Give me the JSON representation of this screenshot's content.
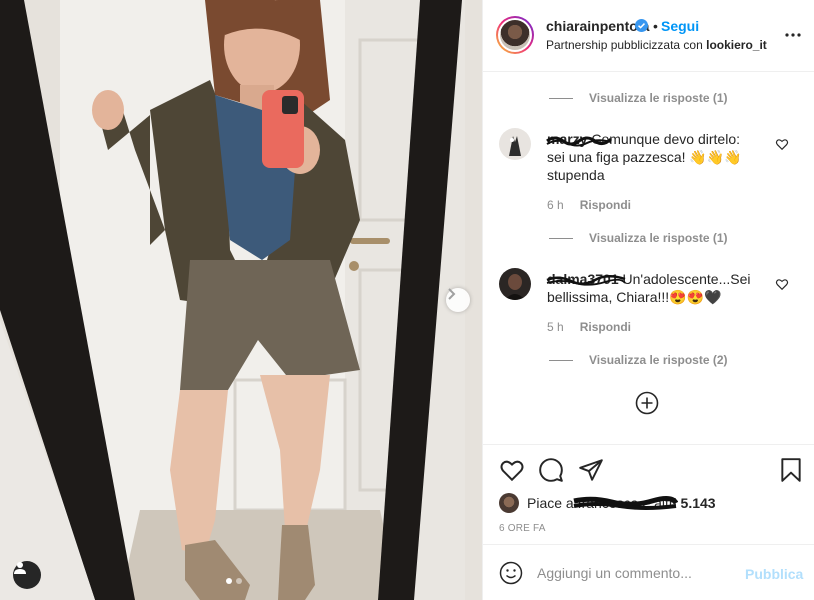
{
  "post": {
    "username": "chiarainpentola",
    "separator": "•",
    "follow_label": "Segui",
    "partnership_prefix": "Partnership pubblicizzata con",
    "partner": "lookiero_it",
    "more_icon": "more-options-icon"
  },
  "comments": {
    "view_replies_1": "Visualizza le risposte (1)",
    "comment_1": {
      "username": "marzy",
      "text": "Comunque devo dirtelo: sei una figa pazzesca! 👋👋👋 stupenda",
      "time": "6 h",
      "reply_label": "Rispondi"
    },
    "view_replies_2": "Visualizza le risposte (1)",
    "comment_2": {
      "username": "dalma3701",
      "text": "Un'adolescente...Sei bellissima, Chiara!!!😍😍🖤",
      "time": "5 h",
      "reply_label": "Rispondi"
    },
    "view_replies_3": "Visualizza le risposte (2)"
  },
  "actions": {
    "likes_prefix": "Piace a",
    "likes_user": "francesca",
    "likes_suffix": "e altri",
    "likes_count": "5.143",
    "timestamp": "6 ORE FA"
  },
  "add_comment": {
    "placeholder": "Aggiungi un commento...",
    "publish_label": "Pubblica"
  },
  "carousel": {
    "total_slides": 2,
    "active_slide": 1
  },
  "colors": {
    "accent": "#0095f6",
    "publish_disabled": "#b2dffc",
    "secondary_text": "#8e8e8e"
  }
}
